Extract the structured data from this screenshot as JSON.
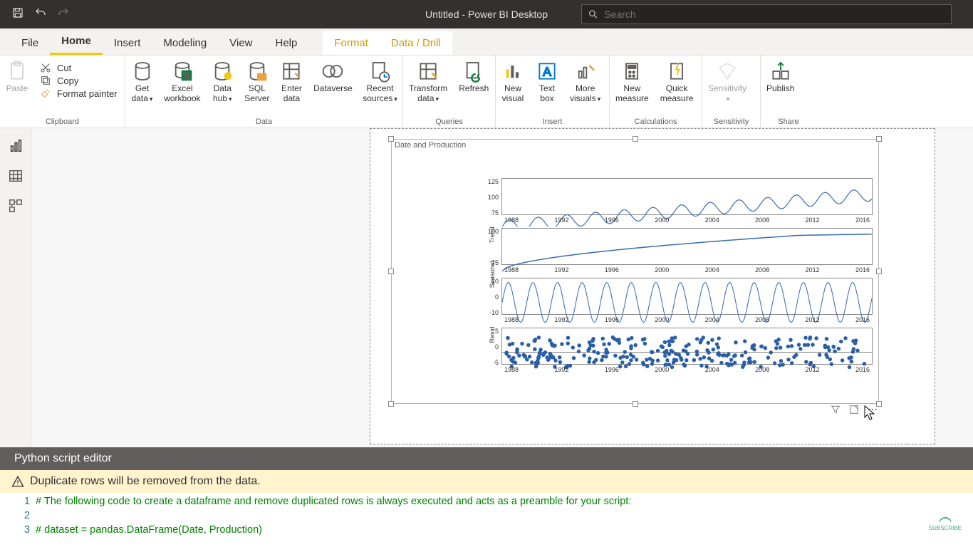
{
  "titlebar": {
    "title": "Untitled - Power BI Desktop",
    "search_placeholder": "Search"
  },
  "tabs": {
    "file": "File",
    "home": "Home",
    "insert": "Insert",
    "modeling": "Modeling",
    "view": "View",
    "help": "Help",
    "format": "Format",
    "datadrill": "Data / Drill"
  },
  "ribbon": {
    "paste": "Paste",
    "cut": "Cut",
    "copy": "Copy",
    "formatpainter": "Format painter",
    "getdata": "Get\ndata",
    "excel": "Excel\nworkbook",
    "datahub": "Data\nhub",
    "sql": "SQL\nServer",
    "enter": "Enter\ndata",
    "dataverse": "Dataverse",
    "recent": "Recent\nsources",
    "transform": "Transform\ndata",
    "refresh": "Refresh",
    "newvisual": "New\nvisual",
    "textbox": "Text\nbox",
    "morevisuals": "More\nvisuals",
    "newmeasure": "New\nmeasure",
    "quickmeasure": "Quick\nmeasure",
    "sensitivity": "Sensitivity",
    "publish": "Publish",
    "g_clipboard": "Clipboard",
    "g_data": "Data",
    "g_queries": "Queries",
    "g_insert": "Insert",
    "g_calc": "Calculations",
    "g_sens": "Sensitivity",
    "g_share": "Share"
  },
  "visual": {
    "title": "Date and Production"
  },
  "editor": {
    "title": "Python script editor",
    "warning": "Duplicate rows will be removed from the data.",
    "line1": "# The following code to create a dataframe and remove duplicated rows is always executed and acts as a preamble for your script:",
    "line2": "",
    "line3": "# dataset = pandas.DataFrame(Date, Production)",
    "n1": "1",
    "n2": "2",
    "n3": "3"
  },
  "chart_data": [
    {
      "type": "line",
      "ylabel": "",
      "ylim": [
        70,
        130
      ],
      "yticks": [
        75,
        100,
        125
      ],
      "xticks": [
        "1988",
        "1992",
        "1996",
        "2000",
        "2004",
        "2008",
        "2012",
        "2016"
      ],
      "desc": "observed production ~70→120 with seasonal oscillation"
    },
    {
      "type": "line",
      "ylabel": "Trend",
      "ylim": [
        65,
        110
      ],
      "yticks": [
        75,
        100
      ],
      "xticks": [
        "1988",
        "1992",
        "1996",
        "2000",
        "2004",
        "2008",
        "2012",
        "2016"
      ],
      "desc": "smooth trend rising 70→105 then plateau"
    },
    {
      "type": "line",
      "ylabel": "Seasonal",
      "ylim": [
        -12,
        12
      ],
      "yticks": [
        -10,
        0,
        10
      ],
      "xticks": [
        "1988",
        "1992",
        "1996",
        "2000",
        "2004",
        "2008",
        "2012",
        "2016"
      ],
      "desc": "repeating annual seasonal cycle ±10"
    },
    {
      "type": "scatter",
      "ylabel": "Resid",
      "ylim": [
        -8,
        8
      ],
      "yticks": [
        -5,
        0,
        5
      ],
      "xticks": [
        "1988",
        "1992",
        "1996",
        "2000",
        "2004",
        "2008",
        "2012",
        "2016"
      ],
      "desc": "residual noise around 0 ±5"
    }
  ]
}
